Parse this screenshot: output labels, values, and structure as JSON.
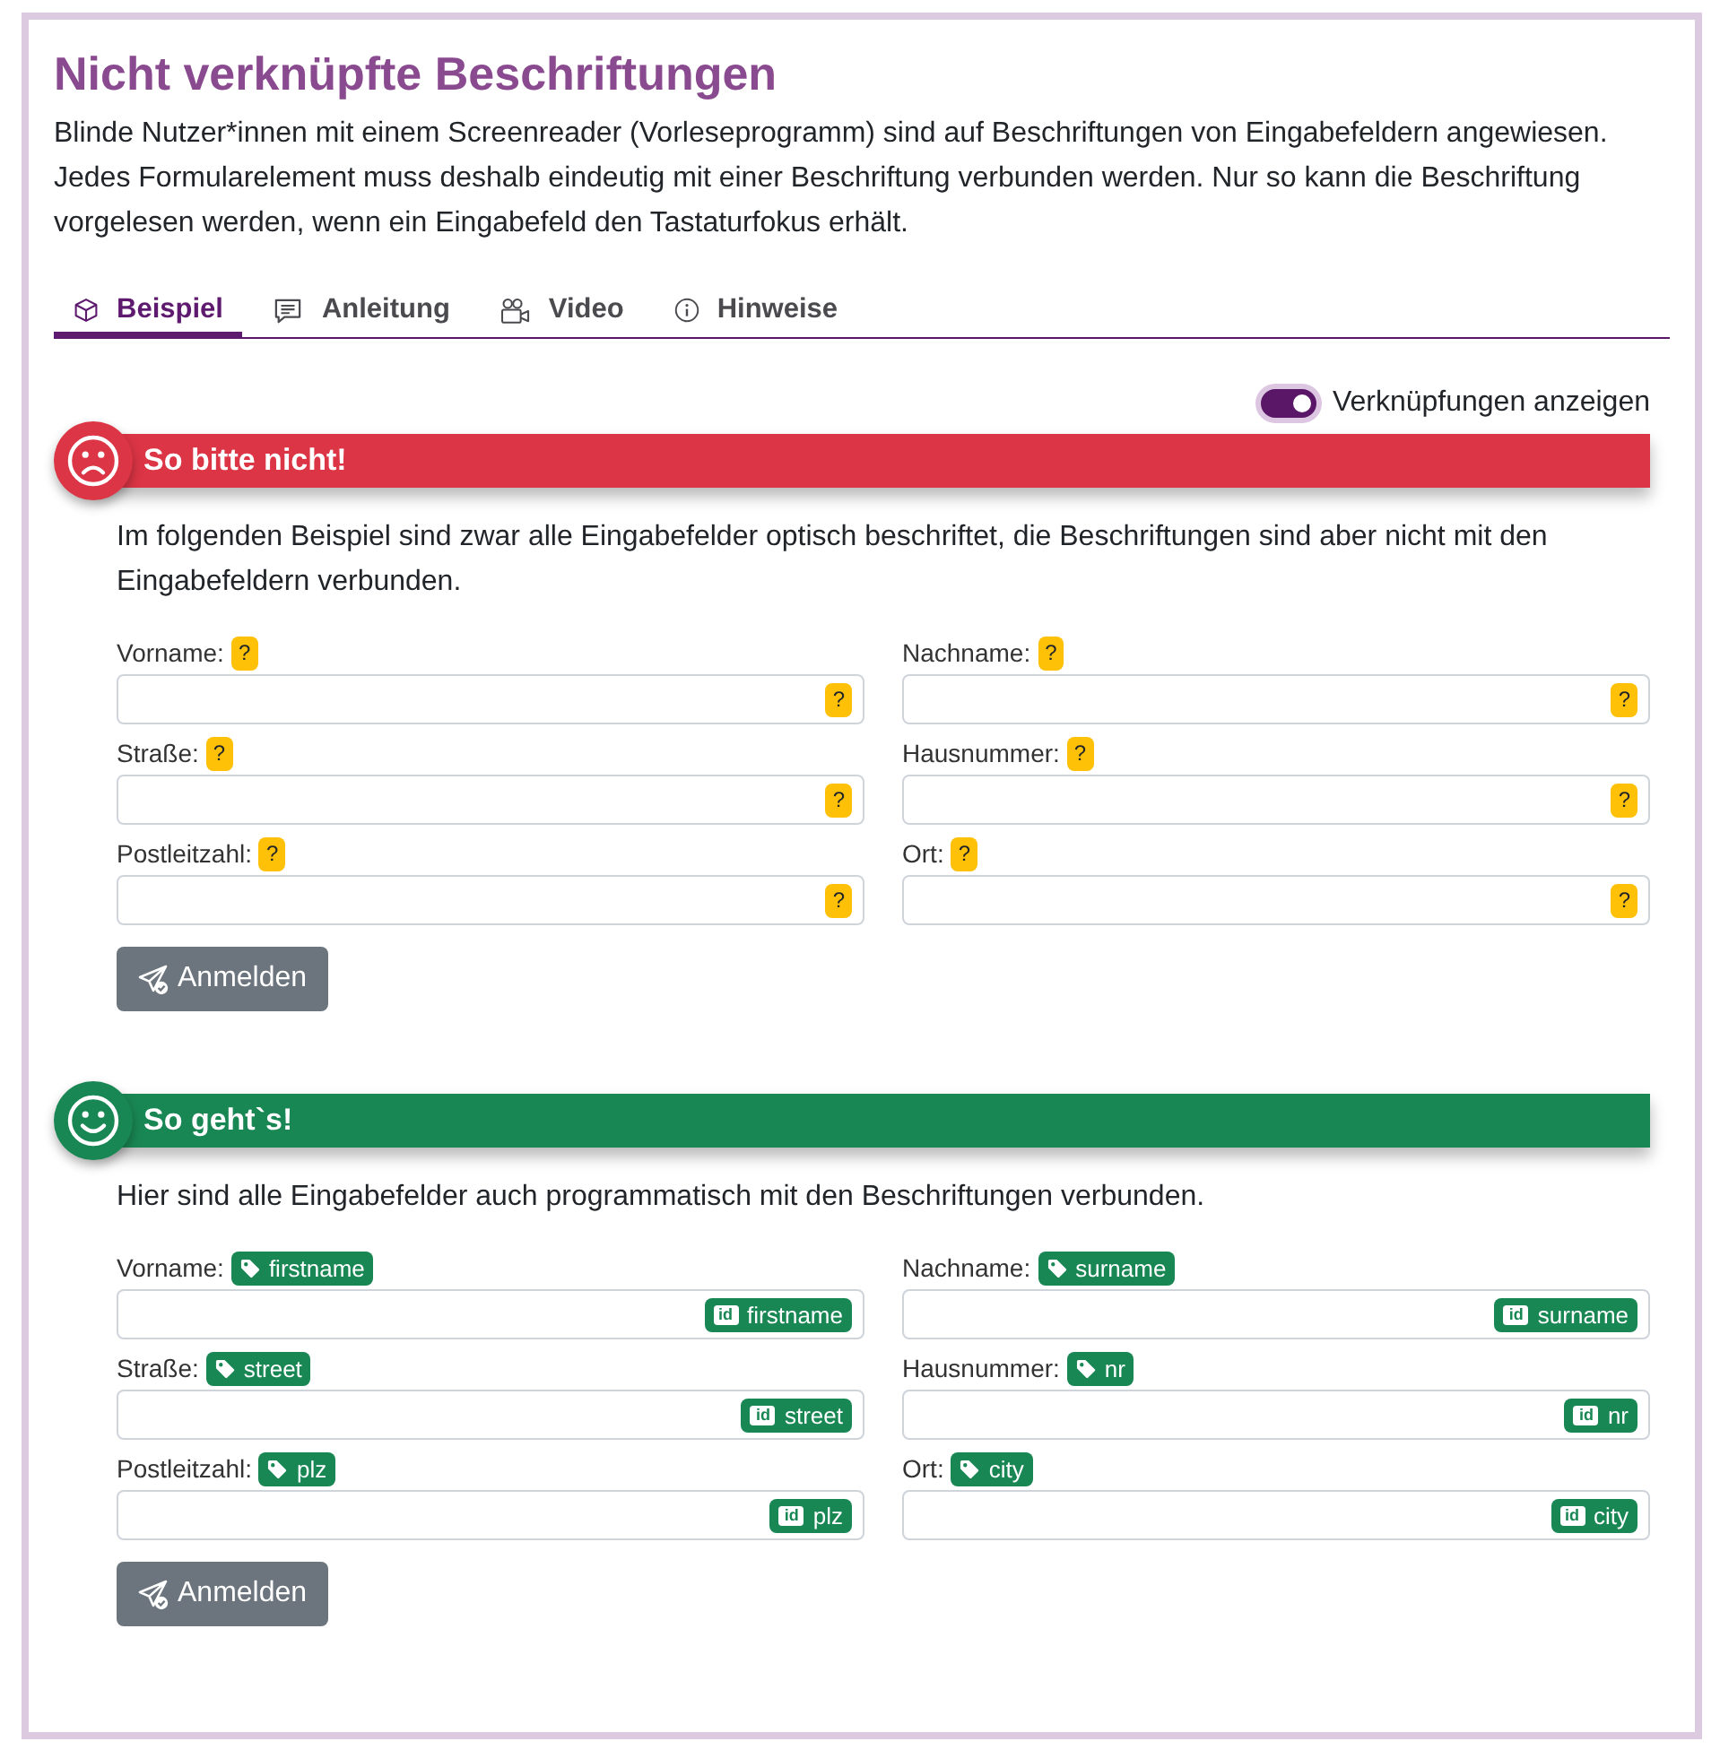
{
  "page_title": "Nicht verknüpfte Beschriftungen",
  "intro": "Blinde Nutzer*innen mit einem Screenreader (Vorleseprogramm) sind auf Beschriftungen von Eingabefeldern angewiesen. Jedes Formularelement muss deshalb eindeutig mit einer Beschriftung verbunden werden. Nur so kann die Beschriftung vorgelesen werden, wenn ein Eingabefeld den Tastaturfokus erhält.",
  "tabs": [
    {
      "label": "Beispiel",
      "selected": true
    },
    {
      "label": "Anleitung",
      "selected": false
    },
    {
      "label": "Video",
      "selected": false
    },
    {
      "label": "Hinweise",
      "selected": false
    }
  ],
  "toggle": {
    "label": "Verknüpfungen anzeigen",
    "on": true
  },
  "sections": [
    {
      "kind": "bad",
      "title": "So bitte nicht!",
      "text": "Im folgenden Beispiel sind zwar alle Eingabefelder optisch beschriftet, die Beschriftungen sind aber nicht mit den Eingabefeldern verbunden.",
      "fields": [
        {
          "label": "Vorname:",
          "label_badge": "?",
          "input_badge": "?"
        },
        {
          "label": "Nachname:",
          "label_badge": "?",
          "input_badge": "?"
        },
        {
          "label": "Straße:",
          "label_badge": "?",
          "input_badge": "?"
        },
        {
          "label": "Hausnummer:",
          "label_badge": "?",
          "input_badge": "?"
        },
        {
          "label": "Postleitzahl:",
          "label_badge": "?",
          "input_badge": "?"
        },
        {
          "label": "Ort:",
          "label_badge": "?",
          "input_badge": "?"
        }
      ],
      "button": "Anmelden"
    },
    {
      "kind": "good",
      "title": "So geht`s!",
      "text": "Hier sind alle Eingabefelder auch programmatisch mit den Beschriftungen verbunden.",
      "fields": [
        {
          "label": "Vorname:",
          "label_badge": "firstname",
          "input_prefix": "id",
          "input_badge": "firstname"
        },
        {
          "label": "Nachname:",
          "label_badge": "surname",
          "input_prefix": "id",
          "input_badge": "surname"
        },
        {
          "label": "Straße:",
          "label_badge": "street",
          "input_prefix": "id",
          "input_badge": "street"
        },
        {
          "label": "Hausnummer:",
          "label_badge": "nr",
          "input_prefix": "id",
          "input_badge": "nr"
        },
        {
          "label": "Postleitzahl:",
          "label_badge": "plz",
          "input_prefix": "id",
          "input_badge": "plz"
        },
        {
          "label": "Ort:",
          "label_badge": "city",
          "input_prefix": "id",
          "input_badge": "city"
        }
      ],
      "button": "Anmelden"
    }
  ]
}
